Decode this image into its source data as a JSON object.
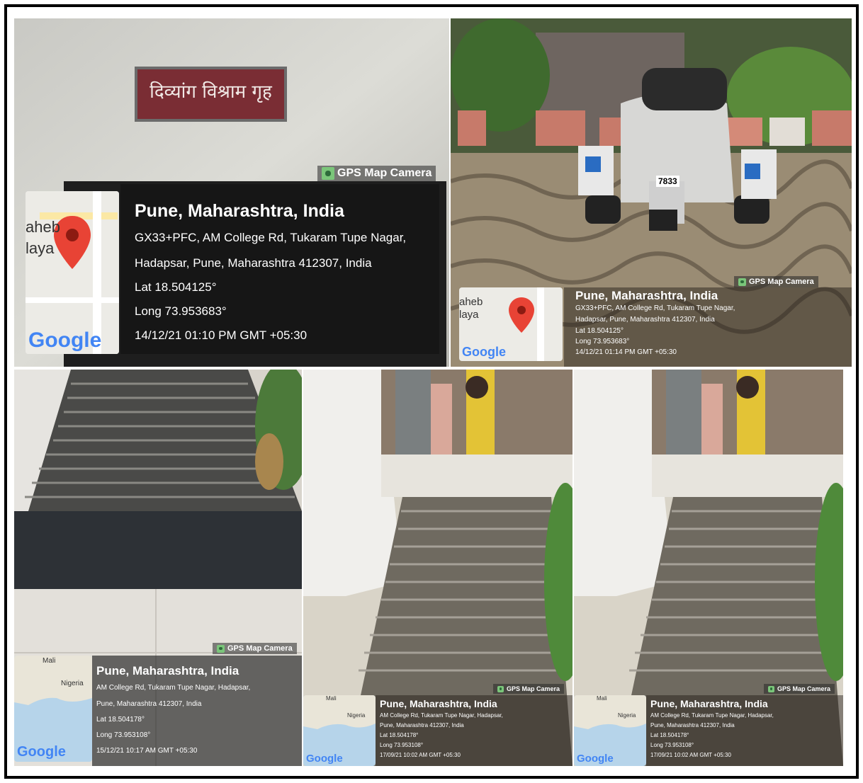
{
  "photos": [
    {
      "sign": "दिव्यांग विश्राम गृह",
      "tag": "GPS Map Camera",
      "city": "Pune, Maharashtra, India",
      "address1": "GX33+PFC, AM College Rd, Tukaram Tupe Nagar,",
      "address2": "Hadapsar, Pune, Maharashtra 412307, India",
      "lat": "Lat 18.504125°",
      "long": "Long 73.953683°",
      "time": "14/12/21 01:10 PM GMT +05:30",
      "map_label1": "aheb",
      "map_label2": "laya",
      "map_brand": "Google"
    },
    {
      "plate": "7833",
      "tag": "GPS Map Camera",
      "city": "Pune, Maharashtra, India",
      "address1": "GX33+PFC, AM College Rd, Tukaram Tupe Nagar,",
      "address2": "Hadapsar, Pune, Maharashtra 412307, India",
      "lat": "Lat 18.504125°",
      "long": "Long 73.953683°",
      "time": "14/12/21 01:14 PM GMT +05:30",
      "map_label1": "aheb",
      "map_label2": "laya",
      "map_brand": "Google"
    },
    {
      "tag": "GPS Map Camera",
      "city": "Pune, Maharashtra, India",
      "address1": "AM College Rd, Tukaram Tupe Nagar, Hadapsar,",
      "address2": "Pune, Maharashtra 412307, India",
      "lat": "Lat 18.504178°",
      "long": "Long 73.953108°",
      "time": "15/12/21 10:17 AM GMT +05:30",
      "map_label1": "Mali",
      "map_label2": "Nigeria",
      "map_brand": "Google"
    },
    {
      "tag": "GPS Map Camera",
      "city": "Pune, Maharashtra, India",
      "address1": "AM College Rd, Tukaram Tupe Nagar, Hadapsar,",
      "address2": "Pune, Maharashtra 412307, India",
      "lat": "Lat 18.504178°",
      "long": "Long 73.953108°",
      "time": "17/09/21 10:02 AM GMT +05:30",
      "map_label1": "Mali",
      "map_label2": "Nigeria",
      "map_brand": "Google"
    },
    {
      "tag": "GPS Map Camera",
      "city": "Pune, Maharashtra, India",
      "address1": "AM College Rd, Tukaram Tupe Nagar, Hadapsar,",
      "address2": "Pune, Maharashtra 412307, India",
      "lat": "Lat 18.504178°",
      "long": "Long 73.953108°",
      "time": "17/09/21 10:02 AM GMT +05:30",
      "map_label1": "Mali",
      "map_label2": "Nigeria",
      "map_brand": "Google"
    }
  ]
}
